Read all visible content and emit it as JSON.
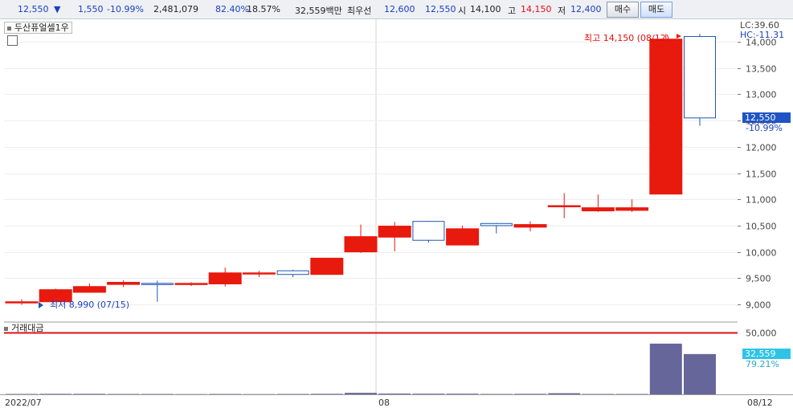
{
  "quote": {
    "price": "12,550",
    "arrow": "▼",
    "change": "1,550",
    "change_pct": "-10.99%",
    "volume": "2,481,079",
    "vol_ratio": "82.40%",
    "turnover": "18.57%",
    "amount": "32,559백만",
    "best_label": "최우선",
    "best_ask": "12,600",
    "best_bid": "12,550",
    "open_label": "시",
    "open": "14,100",
    "high_label": "고",
    "high": "14,150",
    "low_label": "저",
    "low": "12,400"
  },
  "buttons": {
    "buy": "매수",
    "sell": "매도"
  },
  "chart": {
    "name": "두산퓨얼셀1우",
    "lc_label": "LC:39.60",
    "hc_label": "HC:-11.31",
    "high_note": "최고 14,150 (08/12)",
    "low_note": "최저 8,990 (07/15)",
    "last_price_flag": "12,550",
    "last_pct_label": "-10.99%",
    "volume_name": "거래대금",
    "vol_last_flag": "32,559",
    "vol_last_pct": "79.21%",
    "x_start": "2022/07",
    "x_mid": "08",
    "x_end": "08/12",
    "colors": {
      "up": "#e8190d",
      "down_border": "#1f54b8",
      "volume": "#66669a",
      "ref_line": "#e01010"
    }
  },
  "chart_data": {
    "type": "candlestick",
    "y_ticks": [
      "9,000",
      "9,500",
      "10,000",
      "10,500",
      "11,000",
      "11,500",
      "12,000",
      "12,500",
      "13,000",
      "13,500",
      "14,000"
    ],
    "y_range": [
      8800,
      14350
    ],
    "vol_ticks": [
      "50,000"
    ],
    "vol_range": [
      0,
      60000
    ],
    "candles": [
      {
        "o": 9050,
        "h": 9100,
        "l": 8990,
        "c": 9050,
        "v": 300
      },
      {
        "o": 9050,
        "h": 9300,
        "l": 9050,
        "c": 9280,
        "v": 400
      },
      {
        "o": 9230,
        "h": 9400,
        "l": 9230,
        "c": 9340,
        "v": 400
      },
      {
        "o": 9380,
        "h": 9460,
        "l": 9330,
        "c": 9420,
        "v": 300
      },
      {
        "o": 9400,
        "h": 9450,
        "l": 9050,
        "c": 9380,
        "v": 300
      },
      {
        "o": 9380,
        "h": 9420,
        "l": 9350,
        "c": 9400,
        "v": 200
      },
      {
        "o": 9390,
        "h": 9700,
        "l": 9340,
        "c": 9600,
        "v": 300
      },
      {
        "o": 9580,
        "h": 9640,
        "l": 9520,
        "c": 9600,
        "v": 200
      },
      {
        "o": 9640,
        "h": 9660,
        "l": 9520,
        "c": 9570,
        "v": 300
      },
      {
        "o": 9570,
        "h": 9880,
        "l": 9570,
        "c": 9880,
        "v": 400
      },
      {
        "o": 10000,
        "h": 10520,
        "l": 9980,
        "c": 10290,
        "v": 1200
      },
      {
        "o": 10280,
        "h": 10570,
        "l": 10010,
        "c": 10490,
        "v": 600
      },
      {
        "o": 10580,
        "h": 10590,
        "l": 10180,
        "c": 10220,
        "v": 500
      },
      {
        "o": 10130,
        "h": 10500,
        "l": 10130,
        "c": 10440,
        "v": 500
      },
      {
        "o": 10540,
        "h": 10550,
        "l": 10350,
        "c": 10500,
        "v": 300
      },
      {
        "o": 10470,
        "h": 10580,
        "l": 10390,
        "c": 10520,
        "v": 400
      },
      {
        "o": 10880,
        "h": 11120,
        "l": 10640,
        "c": 10880,
        "v": 900
      },
      {
        "o": 10780,
        "h": 11090,
        "l": 10760,
        "c": 10840,
        "v": 300
      },
      {
        "o": 10790,
        "h": 11000,
        "l": 10760,
        "c": 10840,
        "v": 300
      },
      {
        "o": 11100,
        "h": 14150,
        "l": 11100,
        "c": 14050,
        "v": 41000
      },
      {
        "o": 14100,
        "h": 14150,
        "l": 12400,
        "c": 12550,
        "v": 32559
      }
    ]
  }
}
